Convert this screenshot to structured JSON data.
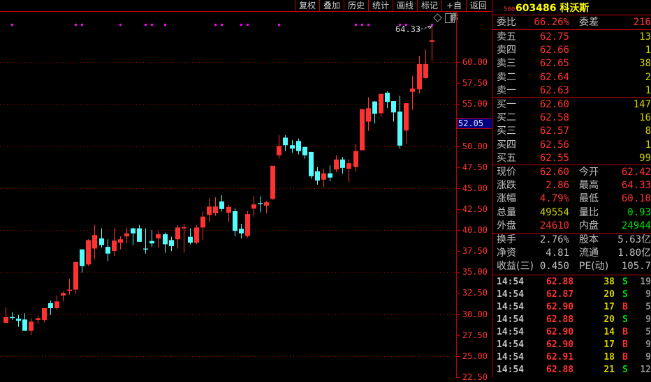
{
  "toolbar": {
    "items": [
      "复权",
      "叠加",
      "历史",
      "统计",
      "画线",
      "标记",
      "+自选",
      "返回"
    ]
  },
  "colors": {
    "up": "#ff3232",
    "down": "#54fcfc",
    "grid": "#c00000",
    "signal": "#ff00ff",
    "highlight": "#000080"
  },
  "stock": {
    "code": "603486",
    "name": "科沃斯",
    "tag": "500"
  },
  "order_book": {
    "ratio_label": "委比",
    "ratio": "66.26%",
    "diff_label": "委差",
    "diff": "216",
    "asks": [
      {
        "label": "卖五",
        "price": "62.75",
        "vol": "13"
      },
      {
        "label": "卖四",
        "price": "62.66",
        "vol": "1"
      },
      {
        "label": "卖三",
        "price": "62.65",
        "vol": "38"
      },
      {
        "label": "卖二",
        "price": "62.64",
        "vol": "2"
      },
      {
        "label": "卖一",
        "price": "62.63",
        "vol": "1"
      }
    ],
    "bids": [
      {
        "label": "买一",
        "price": "62.60",
        "vol": "147"
      },
      {
        "label": "买二",
        "price": "62.58",
        "vol": "16"
      },
      {
        "label": "买三",
        "price": "62.57",
        "vol": "8"
      },
      {
        "label": "买四",
        "price": "62.56",
        "vol": "1"
      },
      {
        "label": "买五",
        "price": "62.55",
        "vol": "99"
      }
    ]
  },
  "quote": [
    {
      "l1": "现价",
      "v1": "62.60",
      "c1": "red",
      "l2": "今开",
      "v2": "62.42",
      "c2": "red"
    },
    {
      "l1": "涨跌",
      "v1": "2.86",
      "c1": "red",
      "l2": "最高",
      "v2": "64.33",
      "c2": "red"
    },
    {
      "l1": "涨幅",
      "v1": "4.79%",
      "c1": "red",
      "l2": "最低",
      "v2": "60.10",
      "c2": "red"
    },
    {
      "l1": "总量",
      "v1": "49554",
      "c1": "yel",
      "l2": "量比",
      "v2": "0.93",
      "c2": "grn"
    },
    {
      "l1": "外盘",
      "v1": "24610",
      "c1": "red",
      "l2": "内盘",
      "v2": "24944",
      "c2": "grn"
    }
  ],
  "fundamentals": [
    {
      "l1": "换手",
      "v1": "2.76%",
      "l2": "股本",
      "v2": "5.63亿"
    },
    {
      "l1": "净资",
      "v1": "4.81",
      "l2": "流通",
      "v2": "1.80亿"
    },
    {
      "l1": "收益(三)",
      "v1": "0.450",
      "l2": "PE(动)",
      "v2": "105.7"
    }
  ],
  "ticks": [
    {
      "time": "14:54",
      "price": "62.88",
      "vol": "38",
      "side": "S",
      "n": "19"
    },
    {
      "time": "14:54",
      "price": "62.87",
      "vol": "20",
      "side": "S",
      "n": "9"
    },
    {
      "time": "14:54",
      "price": "62.90",
      "vol": "17",
      "side": "B",
      "n": "5"
    },
    {
      "time": "14:54",
      "price": "62.88",
      "vol": "20",
      "side": "S",
      "n": "9"
    },
    {
      "time": "14:54",
      "price": "62.90",
      "vol": "14",
      "side": "B",
      "n": "5"
    },
    {
      "time": "14:54",
      "price": "62.90",
      "vol": "17",
      "side": "B",
      "n": "9"
    },
    {
      "time": "14:54",
      "price": "62.91",
      "vol": "18",
      "side": "B",
      "n": "9"
    },
    {
      "time": "14:54",
      "price": "62.88",
      "vol": "21",
      "side": "S",
      "n": "12"
    }
  ],
  "chart_data": {
    "type": "candlestick",
    "ylim": [
      22.5,
      66.5
    ],
    "grid": true,
    "y_ticks": [
      "60.00",
      "57.50",
      "55.00",
      "52.05",
      "50.00",
      "47.50",
      "45.00",
      "42.50",
      "40.00",
      "37.50",
      "35.00",
      "32.50",
      "30.00",
      "27.50",
      "25.00",
      "22.50"
    ],
    "y_tick_values": [
      60,
      57.5,
      55,
      50,
      47.5,
      45,
      42.5,
      40,
      37.5,
      35,
      32.5,
      30,
      27.5,
      25,
      22.5
    ],
    "cursor_price": "52.05",
    "high_annotation": "64.33",
    "signal_indices": [
      1,
      11,
      12,
      18,
      22,
      23,
      25,
      33,
      34,
      37,
      38,
      43,
      55,
      56,
      57,
      62,
      63,
      67
    ],
    "ohlc": [
      [
        28.96,
        30.79,
        28.88,
        29.63
      ],
      [
        29.65,
        30.2,
        29.3,
        29.55
      ],
      [
        29.45,
        29.9,
        28.5,
        29.2
      ],
      [
        29.35,
        30.1,
        28.0,
        28.0
      ],
      [
        28.0,
        29.5,
        27.5,
        29.1
      ],
      [
        29.3,
        29.8,
        28.8,
        29.5
      ],
      [
        29.3,
        30.7,
        29.0,
        30.7
      ],
      [
        31.3,
        31.6,
        29.9,
        30.7
      ],
      [
        30.7,
        32.2,
        30.5,
        31.5
      ],
      [
        32.2,
        32.7,
        31.5,
        32.5
      ],
      [
        32.8,
        34.2,
        32.3,
        32.9
      ],
      [
        32.9,
        36.2,
        32.4,
        36.2
      ],
      [
        37.7,
        37.7,
        34.9,
        35.7
      ],
      [
        35.9,
        38.9,
        35.7,
        38.8
      ],
      [
        37.8,
        40.6,
        36.5,
        39.4
      ],
      [
        39.0,
        40.2,
        37.9,
        38.2
      ],
      [
        38.0,
        38.9,
        36.3,
        37.2
      ],
      [
        37.5,
        40.25,
        36.9,
        38.75
      ],
      [
        38.5,
        39.25,
        37.7,
        38.9
      ],
      [
        39.25,
        40.3,
        38.4,
        39.6
      ],
      [
        40.2,
        40.3,
        38.2,
        39.6
      ],
      [
        40.2,
        40.6,
        38.6,
        38.6
      ],
      [
        37.8,
        40.2,
        37.2,
        37.7
      ],
      [
        38.7,
        40.0,
        38.0,
        38.4
      ],
      [
        39.0,
        39.9,
        37.9,
        39.5
      ],
      [
        39.5,
        39.7,
        37.3,
        38.3
      ],
      [
        38.8,
        39.2,
        37.5,
        38.1
      ],
      [
        38.9,
        40.6,
        37.8,
        40.3
      ],
      [
        40.2,
        40.75,
        37.3,
        40.35
      ],
      [
        39.2,
        40.2,
        38.3,
        38.5
      ],
      [
        38.5,
        40.6,
        38.3,
        40.3
      ],
      [
        40.3,
        42.2,
        38.8,
        41.6
      ],
      [
        41.8,
        43.8,
        41.0,
        42.8
      ],
      [
        42.0,
        43.9,
        41.7,
        42.8
      ],
      [
        43.4,
        44.15,
        42.2,
        42.5
      ],
      [
        42.05,
        43.0,
        41.0,
        42.75
      ],
      [
        42.25,
        42.6,
        39.25,
        39.9
      ],
      [
        40.15,
        40.75,
        39.0,
        39.6
      ],
      [
        39.3,
        42.25,
        39.1,
        41.9
      ],
      [
        42.55,
        44.05,
        41.6,
        43.05
      ],
      [
        43.2,
        44.0,
        42.1,
        43.15
      ],
      [
        42.9,
        43.5,
        42.0,
        43.3
      ],
      [
        43.7,
        47.65,
        43.6,
        47.65
      ],
      [
        48.9,
        51.3,
        48.5,
        50.0
      ],
      [
        51.0,
        51.3,
        49.4,
        50.1
      ],
      [
        50.1,
        50.7,
        49.2,
        49.7
      ],
      [
        50.6,
        50.9,
        49.0,
        49.4
      ],
      [
        49.9,
        49.9,
        48.5,
        48.9
      ],
      [
        49.3,
        49.3,
        46.1,
        46.4
      ],
      [
        47.0,
        47.5,
        45.4,
        45.9
      ],
      [
        46.0,
        47.3,
        45.05,
        46.75
      ],
      [
        46.75,
        47.7,
        45.8,
        46.25
      ],
      [
        47.2,
        48.9,
        46.9,
        48.4
      ],
      [
        48.4,
        48.7,
        46.7,
        47.4
      ],
      [
        47.3,
        48.4,
        45.7,
        47.95
      ],
      [
        47.5,
        50.2,
        46.95,
        49.4
      ],
      [
        49.5,
        54.4,
        49.5,
        54.4
      ],
      [
        52.9,
        55.8,
        51.8,
        54.5
      ],
      [
        55.3,
        55.35,
        52.7,
        53.85
      ],
      [
        53.9,
        56.3,
        53.5,
        56.2
      ],
      [
        56.35,
        56.5,
        54.5,
        55.25
      ],
      [
        55.35,
        55.35,
        52.9,
        54.0
      ],
      [
        54.1,
        56.0,
        49.7,
        50.05
      ],
      [
        51.85,
        55.1,
        50.3,
        55.1
      ],
      [
        56.45,
        58.35,
        54.3,
        56.85
      ],
      [
        56.75,
        60.75,
        56.25,
        59.75
      ],
      [
        58.1,
        61.5,
        58.0,
        59.75
      ],
      [
        62.42,
        64.33,
        60.1,
        62.6
      ]
    ]
  }
}
